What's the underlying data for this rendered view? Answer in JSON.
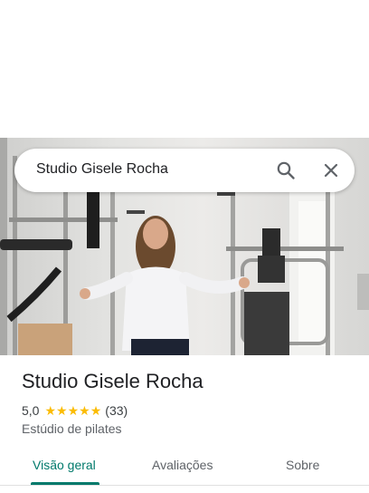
{
  "search": {
    "query": "Studio Gisele Rocha"
  },
  "place": {
    "title": "Studio Gisele Rocha",
    "rating": "5,0",
    "stars": 5,
    "review_count": "(33)",
    "category": "Estúdio de pilates"
  },
  "tabs": [
    {
      "label": "Visão geral",
      "active": true
    },
    {
      "label": "Avaliações",
      "active": false
    },
    {
      "label": "Sobre",
      "active": false
    }
  ],
  "colors": {
    "accent": "#00796b",
    "star": "#fbbc04"
  },
  "icons": {
    "search": "search-icon",
    "close": "close-icon"
  }
}
